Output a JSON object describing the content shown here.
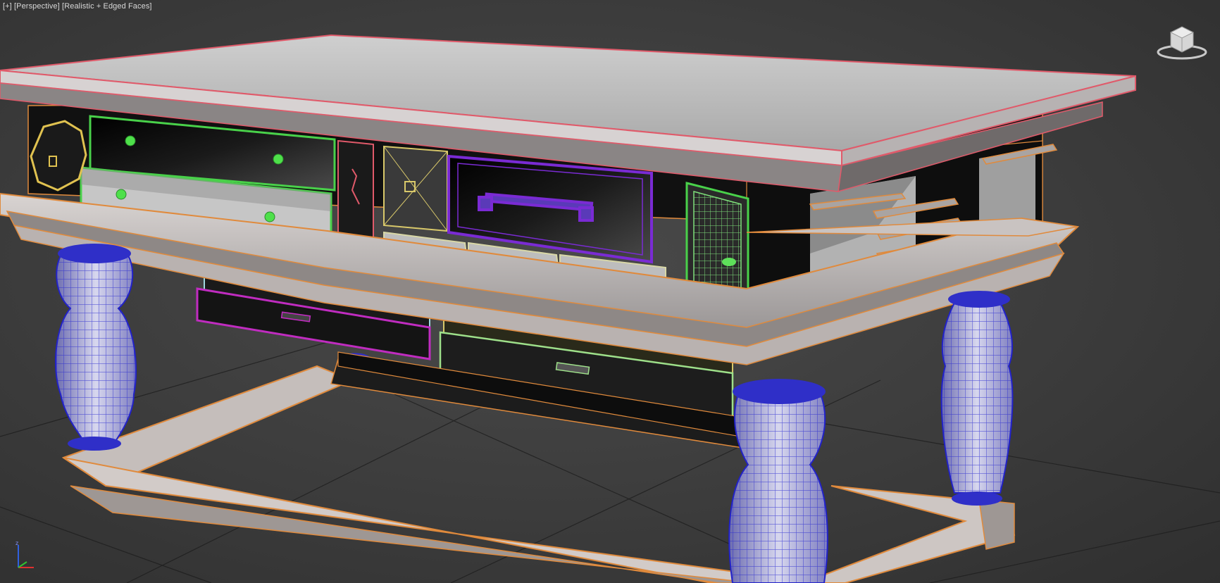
{
  "viewport": {
    "label_menu": "[+]",
    "label_view": "[Perspective]",
    "label_shading": "[Realistic + Edged Faces]"
  },
  "icons": {
    "viewcube": "viewcube-icon",
    "axis_tripod": "axis-tripod-icon"
  },
  "colors": {
    "background": "#3e3e3e",
    "wire_orange": "#e08a3c",
    "wire_pink": "#e05a6a",
    "wire_green": "#49d14a",
    "wire_blue": "#3030d8",
    "wire_purple": "#7a2bd4",
    "wire_magenta": "#c02cc0",
    "wire_yellow": "#d8c86a",
    "wire_lightgreen": "#9ee08a",
    "wire_cyan": "#9fd8e0"
  }
}
